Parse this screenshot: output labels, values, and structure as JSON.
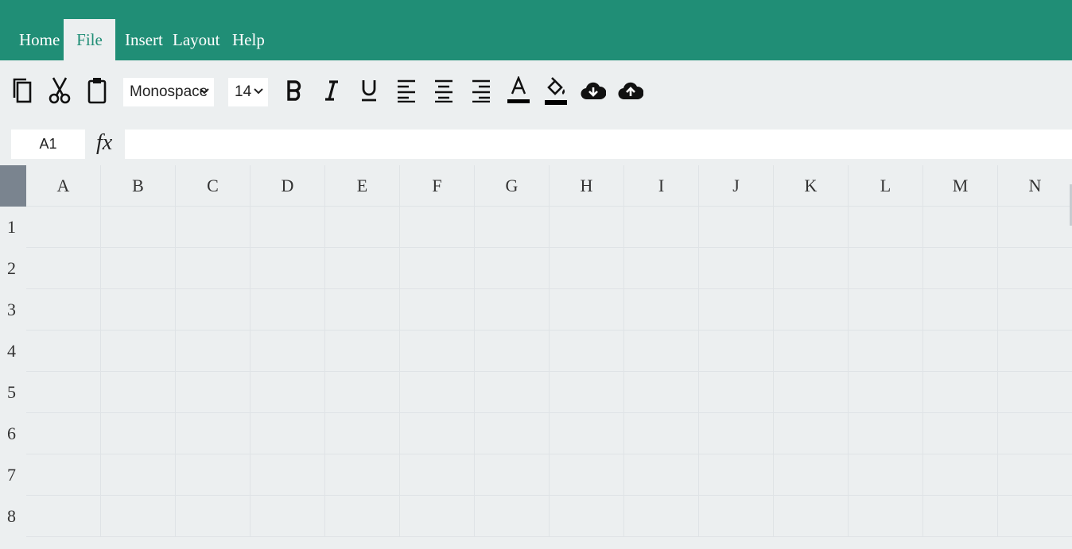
{
  "menu": {
    "items": [
      {
        "label": "Home",
        "active": false
      },
      {
        "label": "File",
        "active": true
      },
      {
        "label": "Insert",
        "active": false
      },
      {
        "label": "Layout",
        "active": false
      },
      {
        "label": "Help",
        "active": false
      }
    ]
  },
  "toolbar": {
    "font_family": "Monospace",
    "font_size": "14",
    "icons": [
      "copy-icon",
      "cut-icon",
      "paste-icon",
      "bold-icon",
      "italic-icon",
      "underline-icon",
      "align-left-icon",
      "align-center-icon",
      "align-right-icon",
      "text-color-icon",
      "fill-color-icon",
      "cloud-download-icon",
      "cloud-upload-icon"
    ],
    "text_color": "#000000",
    "fill_color": "#000000"
  },
  "formula_bar": {
    "cell_ref": "A1",
    "fx_label": "fx",
    "value": ""
  },
  "sheet": {
    "columns": [
      "A",
      "B",
      "C",
      "D",
      "E",
      "F",
      "G",
      "H",
      "I",
      "J",
      "K",
      "L",
      "M",
      "N"
    ],
    "rows": [
      "1",
      "2",
      "3",
      "4",
      "5",
      "6",
      "7",
      "8"
    ]
  },
  "colors": {
    "accent": "#208e76",
    "background": "#eceff0",
    "header_corner": "#7a848f"
  }
}
